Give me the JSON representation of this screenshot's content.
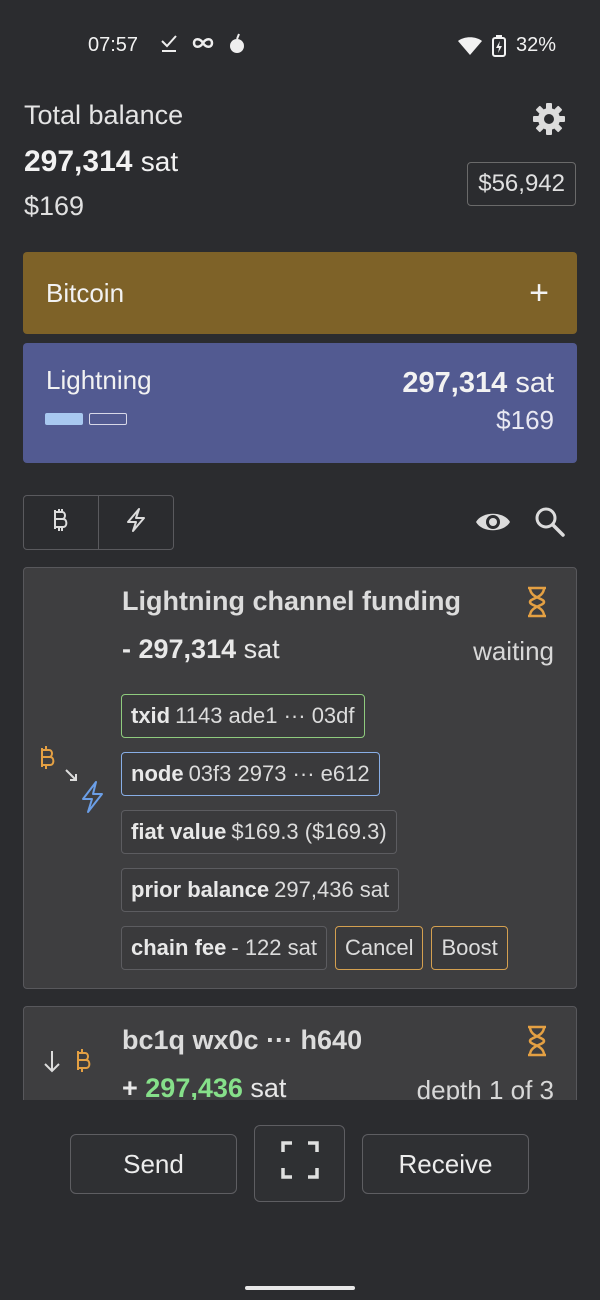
{
  "status_bar": {
    "time": "07:57",
    "battery": "32%",
    "left_icons": [
      "check-download-icon",
      "infinity-icon",
      "bomb-icon"
    ],
    "right_icons": [
      "wifi-icon",
      "battery-charging-icon"
    ]
  },
  "header": {
    "total_label": "Total balance",
    "total_sat_value": "297,314",
    "total_sat_unit": "sat",
    "total_fiat": "$169",
    "btc_rate": "$56,942"
  },
  "wallets": {
    "bitcoin": {
      "label": "Bitcoin",
      "add_label": "+"
    },
    "lightning": {
      "label": "Lightning",
      "sat_value": "297,314",
      "sat_unit": "sat",
      "fiat": "$169",
      "channel_bars": [
        1,
        0
      ]
    }
  },
  "filters": {
    "bitcoin_icon": "bitcoin-icon",
    "lightning_icon": "lightning-icon",
    "eye_icon": "eye-icon",
    "search_icon": "search-icon"
  },
  "transactions": [
    {
      "title": "Lightning channel funding",
      "amount_sign": "- ",
      "amount_value": "297,314",
      "amount_unit": "sat",
      "status": "waiting",
      "chips": {
        "txid_key": "txid",
        "txid_value": "1143 ade1 ··· 03df",
        "node_key": "node",
        "node_value": "03f3 2973 ··· e612",
        "fiat_key": "fiat value",
        "fiat_value": "$169.3 ($169.3)",
        "prior_key": "prior balance",
        "prior_value": "297,436 sat",
        "fee_key": "chain fee",
        "fee_value": "- 122 sat",
        "cancel_label": "Cancel",
        "boost_label": "Boost"
      }
    },
    {
      "title": "bc1q wx0c ··· h640",
      "amount_sign": "+ ",
      "amount_value": "297,436",
      "amount_unit": "sat",
      "status": "depth 1 of 3"
    }
  ],
  "actions": {
    "send_label": "Send",
    "receive_label": "Receive",
    "scan_icon": "scan-icon"
  },
  "colors": {
    "bitcoin_card": "#7e6228",
    "lightning_card": "#525a91",
    "orange_accent": "#e4a043",
    "positive_green": "#86e08a"
  }
}
